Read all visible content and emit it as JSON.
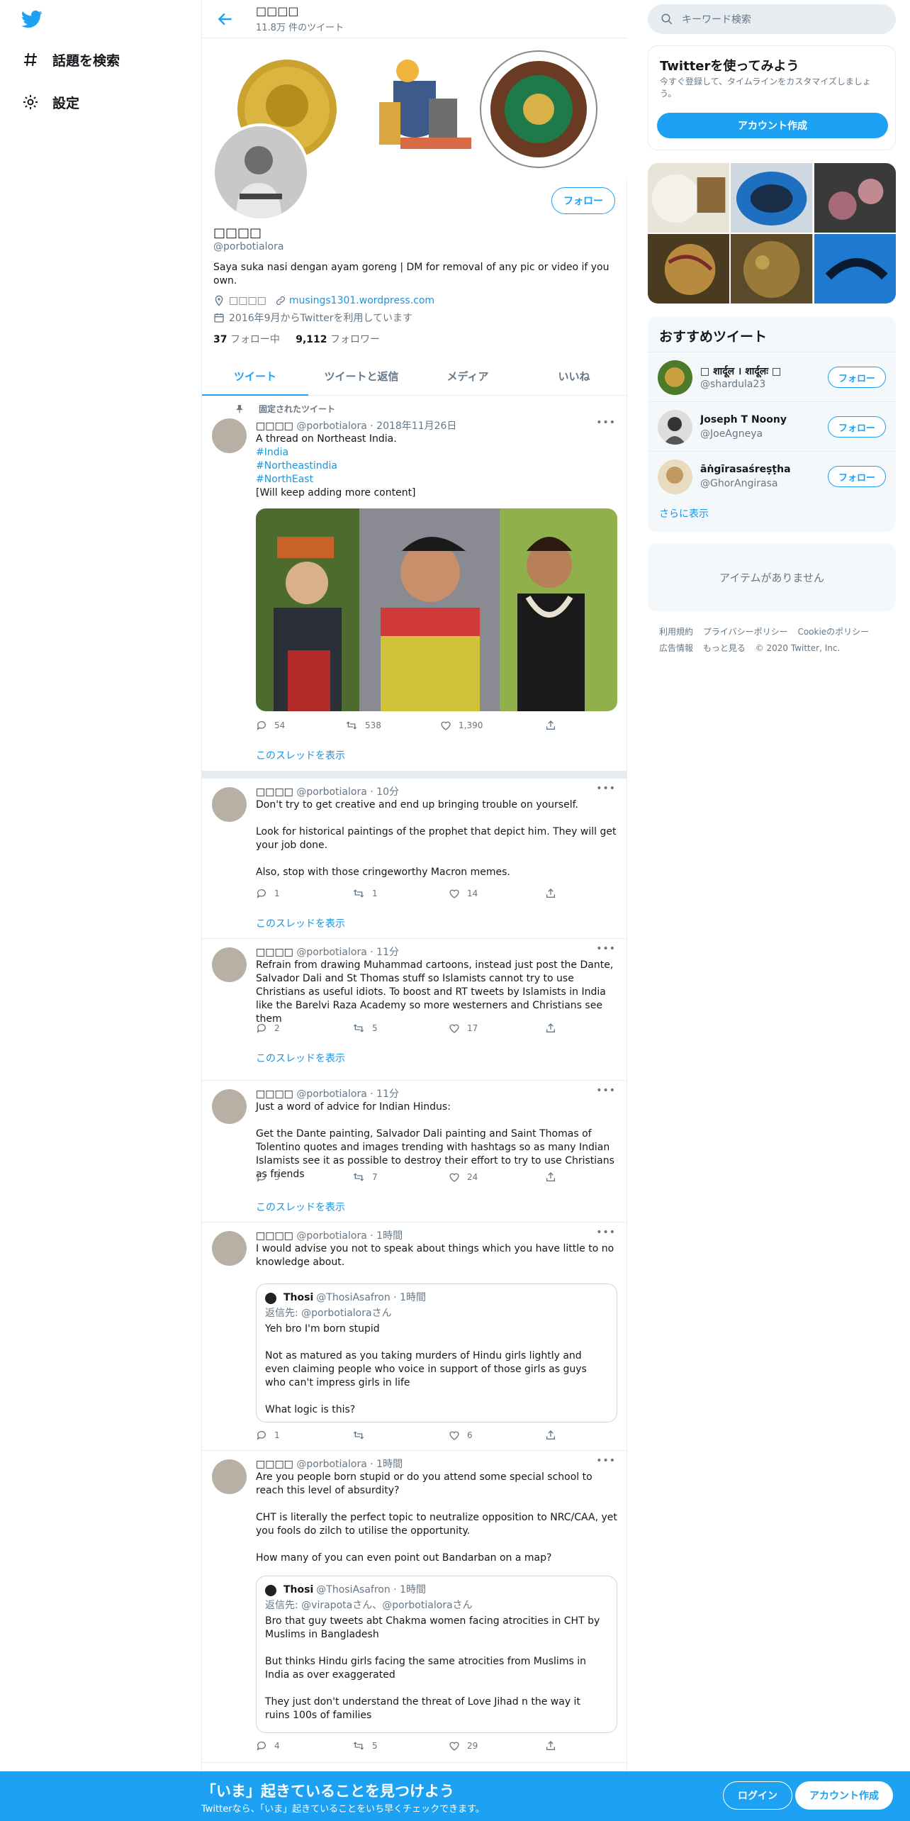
{
  "nav": {
    "explore": "話題を検索",
    "settings": "設定"
  },
  "header": {
    "name": "□□□□",
    "count": "11.8万 件のツイート"
  },
  "profile": {
    "name": "□□□□",
    "handle": "@porbotialora",
    "follow_label": "フォロー",
    "bio": "Saya suka nasi dengan ayam goreng | DM for removal of any pic or video if you own.",
    "location": "□□□□",
    "url": "musings1301.wordpress.com",
    "joined": "2016年9月からTwitterを利用しています",
    "following_count": "37",
    "following_label": "フォロー中",
    "followers_count": "9,112",
    "followers_label": "フォロワー"
  },
  "tabs": [
    "ツイート",
    "ツイートと返信",
    "メディア",
    "いいね"
  ],
  "pinned_label": "固定されたツイート",
  "thread_label": "このスレッドを表示",
  "tweets": [
    {
      "name": "□□□□",
      "handle": "@porbotialora",
      "time": "2018年11月26日",
      "lines": [
        "A thread on Northeast India.",
        "#India",
        "#Northeastindia",
        "#NorthEast",
        "[Will keep adding more content]"
      ],
      "reply": "54",
      "retweet": "538",
      "like": "1,390"
    },
    {
      "name": "□□□□",
      "handle": "@porbotialora",
      "time": "10分",
      "paras": [
        "Don't try to get creative and end up bringing trouble on yourself.",
        "Look for historical paintings of the prophet that depict him. They will get your job done.",
        "Also, stop with those cringeworthy Macron memes."
      ],
      "reply": "1",
      "retweet": "1",
      "like": "14"
    },
    {
      "name": "□□□□",
      "handle": "@porbotialora",
      "time": "11分",
      "paras": [
        "Refrain from drawing Muhammad cartoons, instead just post the Dante, Salvador Dali and St Thomas stuff so Islamists cannot try to use Christians as useful idiots. To boost and RT tweets by Islamists in India like the Barelvi Raza Academy so more westerners and Christians see them"
      ],
      "reply": "2",
      "retweet": "5",
      "like": "17"
    },
    {
      "name": "□□□□",
      "handle": "@porbotialora",
      "time": "11分",
      "paras": [
        "Just a word of advice for Indian Hindus:",
        "Get the Dante painting, Salvador Dali painting and Saint Thomas of Tolentino quotes and images trending with hashtags so as many Indian Islamists see it as possible to destroy their effort to try to use Christians as friends"
      ],
      "reply": "3",
      "retweet": "7",
      "like": "24"
    },
    {
      "name": "□□□□",
      "handle": "@porbotialora",
      "time": "1時間",
      "paras": [
        "I would advise you not to speak about things which you have little to no knowledge about."
      ],
      "quote": {
        "name": "Thosi",
        "handle": "@ThosiAsafron",
        "time": "1時間",
        "reply_to": "返信先: @porbotialoraさん",
        "paras": [
          "Yeh bro I'm born stupid",
          "Not as matured as you taking murders of Hindu girls lightly and even claiming people who voice in support of those girls as guys who can't impress girls in life",
          "What logic is this?"
        ]
      },
      "reply": "1",
      "retweet": "",
      "like": "6"
    },
    {
      "name": "□□□□",
      "handle": "@porbotialora",
      "time": "1時間",
      "paras": [
        "Are you people born stupid or do you attend some special school to reach this level of absurdity?",
        "CHT is literally the perfect topic to neutralize opposition to NRC/CAA, yet you fools do zilch to utilise the opportunity.",
        "How many of you can even point out Bandarban on a map?"
      ],
      "quote": {
        "name": "Thosi",
        "handle": "@ThosiAsafron",
        "time": "1時間",
        "reply_to": "返信先: @virapotaさん、@porbotialoraさん",
        "paras": [
          "Bro that guy tweets abt Chakma women facing atrocities in CHT by Muslims in Bangladesh",
          "But thinks Hindu girls facing the same atrocities from Muslims in India as over exaggerated",
          "They just don't understand the threat of Love Jihad n the way it ruins 100s of families"
        ]
      },
      "reply": "4",
      "retweet": "5",
      "like": "29"
    }
  ],
  "right": {
    "search_placeholder": "キーワード検索",
    "signup_title": "Twitterを使ってみよう",
    "signup_desc": "今すぐ登録して、タイムラインをカスタマイズしましょう。",
    "signup_btn": "アカウント作成",
    "rec_title": "おすすめツイート",
    "recs": [
      {
        "name": "□ शार्दूल । शार्दूलः □",
        "handle": "@shardula23"
      },
      {
        "name": "Joseph T Noony",
        "handle": "@JoeAgneya"
      },
      {
        "name": "āṅgīrasaśreṣṭha",
        "handle": "@GhorAngirasa"
      }
    ],
    "rec_follow": "フォロー",
    "rec_more": "さらに表示",
    "empty": "アイテムがありません",
    "footer": [
      "利用規約",
      "プライバシーポリシー",
      "Cookieのポリシー",
      "広告情報",
      "もっと見る",
      "© 2020 Twitter, Inc."
    ]
  },
  "bottom": {
    "title": "「いま」起きていることを見つけよう",
    "sub": "Twitterなら、「いま」起きていることをいち早くチェックできます。",
    "login": "ログイン",
    "signup": "アカウント作成"
  }
}
